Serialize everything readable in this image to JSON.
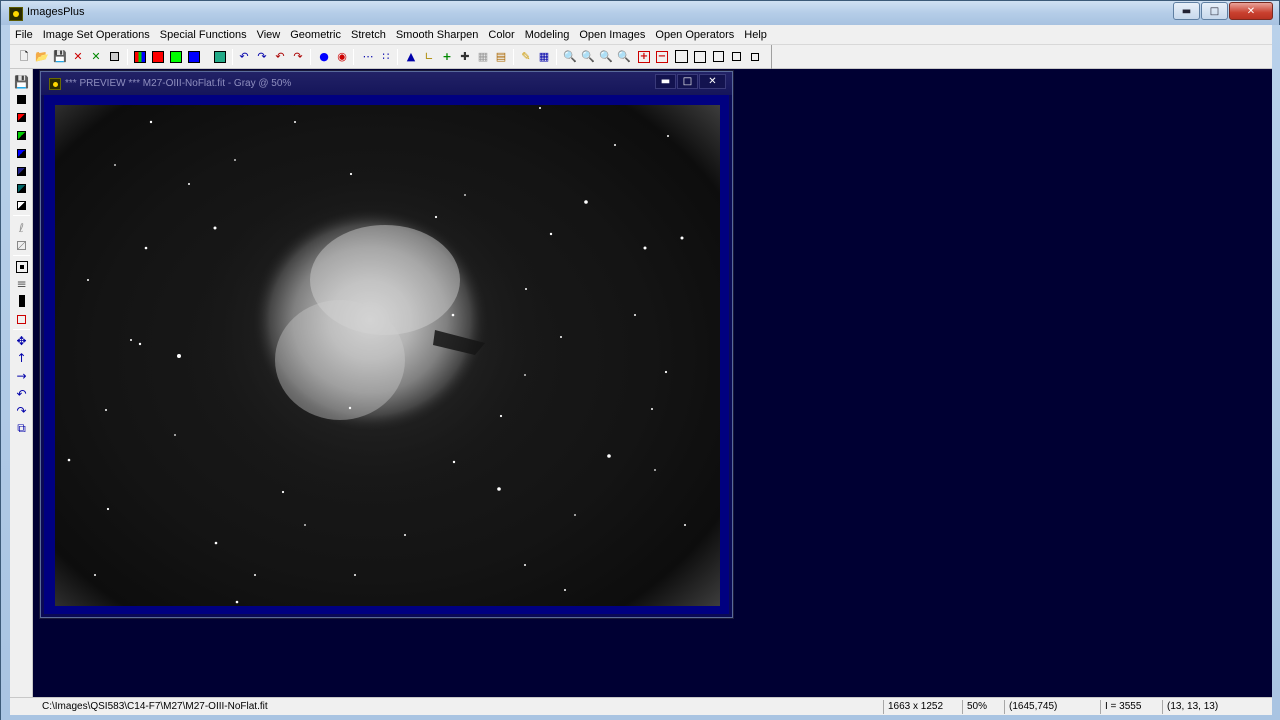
{
  "window": {
    "title": "ImagesPlus",
    "controls": [
      "minimize",
      "maximize",
      "close"
    ]
  },
  "menu": {
    "items": [
      "File",
      "Image Set Operations",
      "Special Functions",
      "View",
      "Geometric",
      "Stretch",
      "Smooth Sharpen",
      "Color",
      "Modeling",
      "Open Images",
      "Open Operators",
      "Help"
    ]
  },
  "toolbar": {
    "buttons": [
      "new-icon",
      "open-icon",
      "save-icon",
      "delete-icon",
      "close-x-icon",
      "calculator-icon",
      "rgb-icon",
      "red-channel-icon",
      "green-channel-icon",
      "blue-channel-icon",
      "grid-icon",
      "undo-icon",
      "redo-icon",
      "undo-all-icon",
      "redo-all-icon",
      "point-icon",
      "red-dot-icon",
      "dots-icon",
      "blob-icon",
      "histogram-icon",
      "curve-icon",
      "crosshair-green-icon",
      "crosshair-icon",
      "dotted-box-icon",
      "chart-icon",
      "pencil-icon",
      "table-icon",
      "zoom-in-icon",
      "zoom-out-icon",
      "zoom-fit-icon",
      "zoom-actual-icon",
      "plus-box-icon",
      "minus-box-icon",
      "square-large-icon",
      "square-icon",
      "square-medium-icon",
      "square-small-icon",
      "square-tiny-icon"
    ]
  },
  "left_toolbar": {
    "buttons": [
      "save-small-icon",
      "black-white-icon",
      "red-black-icon",
      "green-black-icon",
      "blue-black-icon",
      "blue-dark-icon",
      "teal-dark-icon",
      "corner-icon",
      "pen-gray-icon",
      "slash-gray-icon",
      "frame-icon",
      "bars-icon",
      "black-bar-icon",
      "select-icon",
      "move-icon",
      "arrow-up-icon",
      "arrow-right-icon",
      "rotate-left-icon",
      "rotate-right-icon",
      "copy-icon"
    ]
  },
  "child_window": {
    "title": "*** PREVIEW *** M27-OIII-NoFlat.fit - Gray @ 50%",
    "controls": [
      "minimize",
      "maximize",
      "close"
    ]
  },
  "status": {
    "path": "C:\\Images\\QSI583\\C14-F7\\M27\\M27-OIII-NoFlat.fit",
    "size": "1663 x 1252",
    "zoom": "50%",
    "coords": "(1645,745)",
    "intensity": "I = 3555",
    "rgb": "(13, 13, 13)"
  },
  "colors": {
    "mdi_background": "#000033",
    "child_frame": "#000080",
    "titlebar": "#b9d1ea"
  }
}
